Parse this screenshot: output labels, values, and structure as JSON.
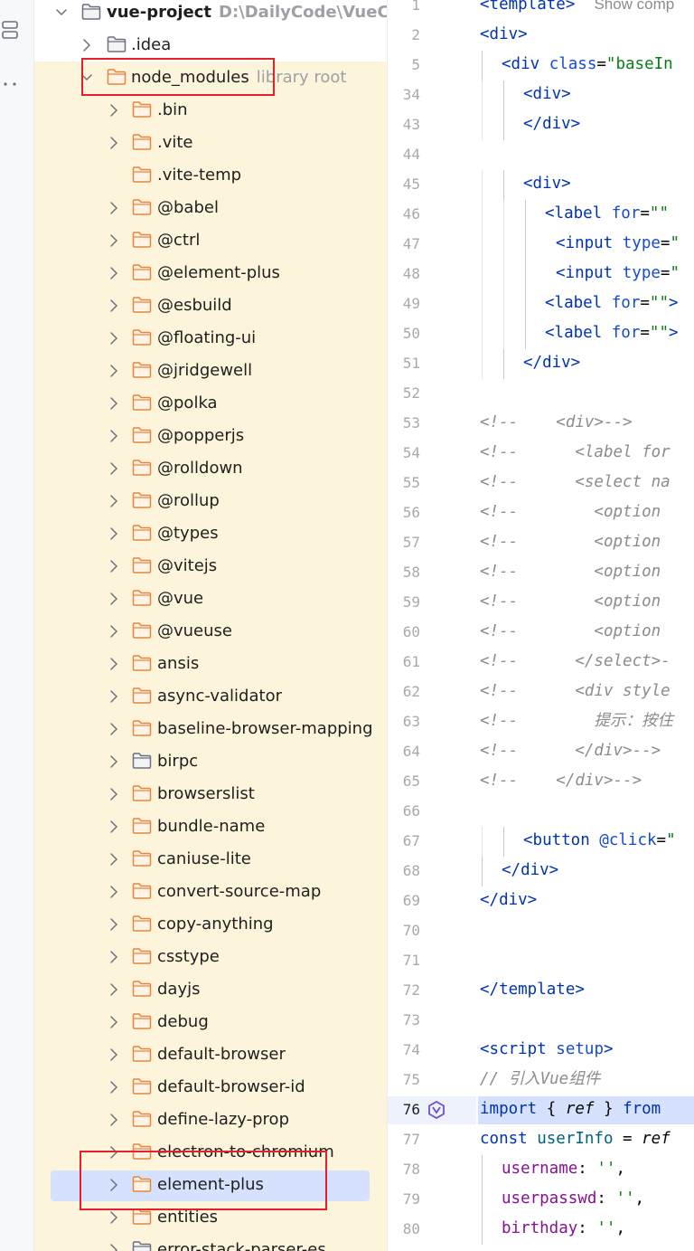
{
  "project": {
    "name": "vue-project",
    "path": "D:\\DailyCode\\VueCode",
    "library_hint": "library root",
    "rows": [
      {
        "label": "vue-project",
        "depth": 0,
        "chevron": "down",
        "folder": "gray",
        "bold": true,
        "hint": "D:\\DailyCode\\VueCode"
      },
      {
        "label": ".idea",
        "depth": 1,
        "chevron": "right",
        "folder": "gray"
      },
      {
        "label": "node_modules",
        "depth": 1,
        "chevron": "down",
        "folder": "orange",
        "hint": "library root",
        "lib": true,
        "boxed": true
      },
      {
        "label": ".bin",
        "depth": 2,
        "chevron": "right",
        "folder": "orange",
        "lib": true
      },
      {
        "label": ".vite",
        "depth": 2,
        "chevron": "right",
        "folder": "orange",
        "lib": true
      },
      {
        "label": ".vite-temp",
        "depth": 2,
        "chevron": "none",
        "folder": "orange",
        "lib": true
      },
      {
        "label": "@babel",
        "depth": 2,
        "chevron": "right",
        "folder": "orange",
        "lib": true
      },
      {
        "label": "@ctrl",
        "depth": 2,
        "chevron": "right",
        "folder": "orange",
        "lib": true
      },
      {
        "label": "@element-plus",
        "depth": 2,
        "chevron": "right",
        "folder": "orange",
        "lib": true
      },
      {
        "label": "@esbuild",
        "depth": 2,
        "chevron": "right",
        "folder": "orange",
        "lib": true
      },
      {
        "label": "@floating-ui",
        "depth": 2,
        "chevron": "right",
        "folder": "orange",
        "lib": true
      },
      {
        "label": "@jridgewell",
        "depth": 2,
        "chevron": "right",
        "folder": "orange",
        "lib": true
      },
      {
        "label": "@polka",
        "depth": 2,
        "chevron": "right",
        "folder": "orange",
        "lib": true
      },
      {
        "label": "@popperjs",
        "depth": 2,
        "chevron": "right",
        "folder": "orange",
        "lib": true
      },
      {
        "label": "@rolldown",
        "depth": 2,
        "chevron": "right",
        "folder": "orange",
        "lib": true
      },
      {
        "label": "@rollup",
        "depth": 2,
        "chevron": "right",
        "folder": "orange",
        "lib": true
      },
      {
        "label": "@types",
        "depth": 2,
        "chevron": "right",
        "folder": "orange",
        "lib": true
      },
      {
        "label": "@vitejs",
        "depth": 2,
        "chevron": "right",
        "folder": "orange",
        "lib": true
      },
      {
        "label": "@vue",
        "depth": 2,
        "chevron": "right",
        "folder": "orange",
        "lib": true
      },
      {
        "label": "@vueuse",
        "depth": 2,
        "chevron": "right",
        "folder": "orange",
        "lib": true
      },
      {
        "label": "ansis",
        "depth": 2,
        "chevron": "right",
        "folder": "orange",
        "lib": true
      },
      {
        "label": "async-validator",
        "depth": 2,
        "chevron": "right",
        "folder": "orange",
        "lib": true
      },
      {
        "label": "baseline-browser-mapping",
        "depth": 2,
        "chevron": "right",
        "folder": "orange",
        "lib": true
      },
      {
        "label": "birpc",
        "depth": 2,
        "chevron": "right",
        "folder": "gray",
        "lib": true
      },
      {
        "label": "browserslist",
        "depth": 2,
        "chevron": "right",
        "folder": "orange",
        "lib": true
      },
      {
        "label": "bundle-name",
        "depth": 2,
        "chevron": "right",
        "folder": "orange",
        "lib": true
      },
      {
        "label": "caniuse-lite",
        "depth": 2,
        "chevron": "right",
        "folder": "orange",
        "lib": true
      },
      {
        "label": "convert-source-map",
        "depth": 2,
        "chevron": "right",
        "folder": "orange",
        "lib": true
      },
      {
        "label": "copy-anything",
        "depth": 2,
        "chevron": "right",
        "folder": "orange",
        "lib": true
      },
      {
        "label": "csstype",
        "depth": 2,
        "chevron": "right",
        "folder": "orange",
        "lib": true
      },
      {
        "label": "dayjs",
        "depth": 2,
        "chevron": "right",
        "folder": "orange",
        "lib": true
      },
      {
        "label": "debug",
        "depth": 2,
        "chevron": "right",
        "folder": "orange",
        "lib": true
      },
      {
        "label": "default-browser",
        "depth": 2,
        "chevron": "right",
        "folder": "orange",
        "lib": true
      },
      {
        "label": "default-browser-id",
        "depth": 2,
        "chevron": "right",
        "folder": "orange",
        "lib": true
      },
      {
        "label": "define-lazy-prop",
        "depth": 2,
        "chevron": "right",
        "folder": "orange",
        "lib": true
      },
      {
        "label": "electron-to-chromium",
        "depth": 2,
        "chevron": "right",
        "folder": "orange",
        "lib": true
      },
      {
        "label": "element-plus",
        "depth": 2,
        "chevron": "right",
        "folder": "orange",
        "lib": true,
        "selected": true,
        "boxed": true
      },
      {
        "label": "entities",
        "depth": 2,
        "chevron": "right",
        "folder": "orange",
        "lib": true
      },
      {
        "label": "error-stack-parser-es",
        "depth": 2,
        "chevron": "right",
        "folder": "gray",
        "lib": true
      }
    ]
  },
  "editor": {
    "highlighted_line": "76",
    "lines": [
      {
        "n": "1",
        "indent": 0,
        "parts": [
          [
            "tag",
            "<template>"
          ],
          [
            "plain",
            "  "
          ],
          [
            "hint",
            "Show comp"
          ]
        ]
      },
      {
        "n": "2",
        "indent": 0,
        "parts": [
          [
            "tag",
            "<div>"
          ]
        ]
      },
      {
        "n": "5",
        "indent": 1,
        "parts": [
          [
            "tag",
            "<div "
          ],
          [
            "attr",
            "class"
          ],
          [
            "plain",
            "="
          ],
          [
            "str",
            "\"baseIn"
          ]
        ]
      },
      {
        "n": "34",
        "indent": 2,
        "parts": [
          [
            "tag",
            "<div>"
          ]
        ]
      },
      {
        "n": "43",
        "indent": 2,
        "parts": [
          [
            "tag",
            "</div>"
          ]
        ]
      },
      {
        "n": "44",
        "indent": 0,
        "parts": []
      },
      {
        "n": "45",
        "indent": 2,
        "parts": [
          [
            "tag",
            "<div>"
          ]
        ]
      },
      {
        "n": "46",
        "indent": 3,
        "parts": [
          [
            "tag",
            "<label "
          ],
          [
            "attr",
            "for"
          ],
          [
            "plain",
            "="
          ],
          [
            "str",
            "\"\" "
          ]
        ]
      },
      {
        "n": "47",
        "indent": 3.5,
        "parts": [
          [
            "tag",
            "<input "
          ],
          [
            "attr",
            "type"
          ],
          [
            "plain",
            "="
          ],
          [
            "str",
            "\""
          ]
        ]
      },
      {
        "n": "48",
        "indent": 3.5,
        "parts": [
          [
            "tag",
            "<input "
          ],
          [
            "attr",
            "type"
          ],
          [
            "plain",
            "="
          ],
          [
            "str",
            "\""
          ]
        ]
      },
      {
        "n": "49",
        "indent": 3,
        "parts": [
          [
            "tag",
            "<label "
          ],
          [
            "attr",
            "for"
          ],
          [
            "plain",
            "="
          ],
          [
            "str",
            "\"\""
          ],
          [
            "tag",
            ">"
          ]
        ]
      },
      {
        "n": "50",
        "indent": 3,
        "parts": [
          [
            "tag",
            "<label "
          ],
          [
            "attr",
            "for"
          ],
          [
            "plain",
            "="
          ],
          [
            "str",
            "\"\""
          ],
          [
            "tag",
            ">"
          ]
        ]
      },
      {
        "n": "51",
        "indent": 2,
        "parts": [
          [
            "tag",
            "</div>"
          ]
        ]
      },
      {
        "n": "52",
        "indent": 0,
        "parts": []
      },
      {
        "n": "53",
        "indent": 0,
        "parts": [
          [
            "com",
            "<!--    <div>-->"
          ]
        ]
      },
      {
        "n": "54",
        "indent": 0,
        "parts": [
          [
            "com",
            "<!--      <label for"
          ]
        ]
      },
      {
        "n": "55",
        "indent": 0,
        "parts": [
          [
            "com",
            "<!--      <select na"
          ]
        ]
      },
      {
        "n": "56",
        "indent": 0,
        "parts": [
          [
            "com",
            "<!--        <option "
          ]
        ]
      },
      {
        "n": "57",
        "indent": 0,
        "parts": [
          [
            "com",
            "<!--        <option "
          ]
        ]
      },
      {
        "n": "58",
        "indent": 0,
        "parts": [
          [
            "com",
            "<!--        <option "
          ]
        ]
      },
      {
        "n": "59",
        "indent": 0,
        "parts": [
          [
            "com",
            "<!--        <option "
          ]
        ]
      },
      {
        "n": "60",
        "indent": 0,
        "parts": [
          [
            "com",
            "<!--        <option "
          ]
        ]
      },
      {
        "n": "61",
        "indent": 0,
        "parts": [
          [
            "com",
            "<!--      </select>-"
          ]
        ]
      },
      {
        "n": "62",
        "indent": 0,
        "parts": [
          [
            "com",
            "<!--      <div style"
          ]
        ]
      },
      {
        "n": "63",
        "indent": 0,
        "parts": [
          [
            "com",
            "<!--        提示：按住"
          ]
        ]
      },
      {
        "n": "64",
        "indent": 0,
        "parts": [
          [
            "com",
            "<!--      </div>-->"
          ]
        ]
      },
      {
        "n": "65",
        "indent": 0,
        "parts": [
          [
            "com",
            "<!--    </div>-->"
          ]
        ]
      },
      {
        "n": "66",
        "indent": 0,
        "parts": []
      },
      {
        "n": "67",
        "indent": 2,
        "parts": [
          [
            "tag",
            "<button "
          ],
          [
            "attr",
            "@click"
          ],
          [
            "plain",
            "="
          ],
          [
            "str",
            "\""
          ]
        ]
      },
      {
        "n": "68",
        "indent": 1,
        "parts": [
          [
            "tag",
            "</div>"
          ]
        ]
      },
      {
        "n": "69",
        "indent": 0,
        "parts": [
          [
            "tag",
            "</div>"
          ]
        ]
      },
      {
        "n": "70",
        "indent": 0,
        "parts": []
      },
      {
        "n": "71",
        "indent": 0,
        "parts": []
      },
      {
        "n": "72",
        "indent": 0,
        "parts": [
          [
            "tag",
            "</template>"
          ]
        ]
      },
      {
        "n": "73",
        "indent": 0,
        "parts": []
      },
      {
        "n": "74",
        "indent": 0,
        "parts": [
          [
            "tag",
            "<script "
          ],
          [
            "attr",
            "setup"
          ],
          [
            "tag",
            ">"
          ]
        ]
      },
      {
        "n": "75",
        "indent": 0,
        "parts": [
          [
            "com",
            "// 引入Vue组件"
          ]
        ]
      },
      {
        "n": "76",
        "indent": 0,
        "parts": [
          [
            "kw",
            "import "
          ],
          [
            "plain",
            "{ "
          ],
          [
            "ref",
            "ref"
          ],
          [
            "plain",
            " } "
          ],
          [
            "kw",
            "from "
          ]
        ],
        "highlight": true
      },
      {
        "n": "77",
        "indent": 0,
        "parts": [
          [
            "kw",
            "const "
          ],
          [
            "var",
            "userInfo"
          ],
          [
            "plain",
            " = "
          ],
          [
            "ref",
            "ref"
          ]
        ]
      },
      {
        "n": "78",
        "indent": 1,
        "parts": [
          [
            "prop",
            "username"
          ],
          [
            "plain",
            ": "
          ],
          [
            "str",
            "''"
          ],
          [
            "plain",
            ","
          ]
        ]
      },
      {
        "n": "79",
        "indent": 1,
        "parts": [
          [
            "prop",
            "userpasswd"
          ],
          [
            "plain",
            ": "
          ],
          [
            "str",
            "''"
          ],
          [
            "plain",
            ","
          ]
        ]
      },
      {
        "n": "80",
        "indent": 1,
        "parts": [
          [
            "prop",
            "birthday"
          ],
          [
            "plain",
            ": "
          ],
          [
            "str",
            "''"
          ],
          [
            "plain",
            ","
          ]
        ]
      }
    ]
  },
  "colors": {
    "lib_bg": "#fdf4dc",
    "selection": "#d5e1fd",
    "folder_orange": "#e8853a",
    "folder_gray": "#6c707e",
    "red_box": "#e5202a"
  }
}
